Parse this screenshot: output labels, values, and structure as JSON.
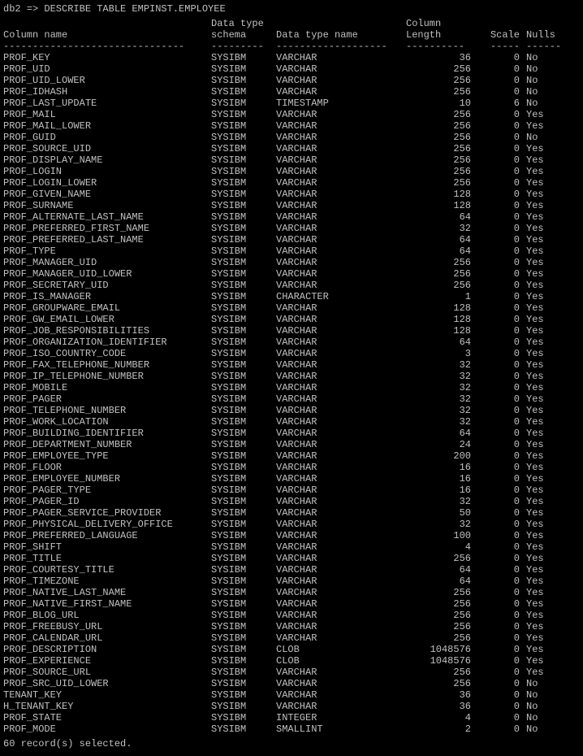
{
  "command": "db2 => DESCRIBE TABLE EMPINST.EMPLOYEE",
  "headers": {
    "col1a": "",
    "col1b": "Column name",
    "col2a": "Data type",
    "col2b": "schema",
    "col3a": "",
    "col3b": "Data type name",
    "col4a": "Column",
    "col4b": "Length",
    "col5a": "",
    "col5b": "Scale",
    "col6a": "",
    "col6b": "Nulls"
  },
  "dashes": {
    "col1": "-------------------------------",
    "col2": "---------",
    "col3": "-------------------",
    "col4": "----------",
    "col5": "-----",
    "col6": "------"
  },
  "rows": [
    {
      "name": "PROF_KEY",
      "schema": "SYSIBM",
      "type": "VARCHAR",
      "length": "36",
      "scale": "0",
      "nulls": "No"
    },
    {
      "name": "PROF_UID",
      "schema": "SYSIBM",
      "type": "VARCHAR",
      "length": "256",
      "scale": "0",
      "nulls": "No"
    },
    {
      "name": "PROF_UID_LOWER",
      "schema": "SYSIBM",
      "type": "VARCHAR",
      "length": "256",
      "scale": "0",
      "nulls": "No"
    },
    {
      "name": "PROF_IDHASH",
      "schema": "SYSIBM",
      "type": "VARCHAR",
      "length": "256",
      "scale": "0",
      "nulls": "No"
    },
    {
      "name": "PROF_LAST_UPDATE",
      "schema": "SYSIBM",
      "type": "TIMESTAMP",
      "length": "10",
      "scale": "6",
      "nulls": "No"
    },
    {
      "name": "PROF_MAIL",
      "schema": "SYSIBM",
      "type": "VARCHAR",
      "length": "256",
      "scale": "0",
      "nulls": "Yes"
    },
    {
      "name": "PROF_MAIL_LOWER",
      "schema": "SYSIBM",
      "type": "VARCHAR",
      "length": "256",
      "scale": "0",
      "nulls": "Yes"
    },
    {
      "name": "PROF_GUID",
      "schema": "SYSIBM",
      "type": "VARCHAR",
      "length": "256",
      "scale": "0",
      "nulls": "No"
    },
    {
      "name": "PROF_SOURCE_UID",
      "schema": "SYSIBM",
      "type": "VARCHAR",
      "length": "256",
      "scale": "0",
      "nulls": "Yes"
    },
    {
      "name": "PROF_DISPLAY_NAME",
      "schema": "SYSIBM",
      "type": "VARCHAR",
      "length": "256",
      "scale": "0",
      "nulls": "Yes"
    },
    {
      "name": "PROF_LOGIN",
      "schema": "SYSIBM",
      "type": "VARCHAR",
      "length": "256",
      "scale": "0",
      "nulls": "Yes"
    },
    {
      "name": "PROF_LOGIN_LOWER",
      "schema": "SYSIBM",
      "type": "VARCHAR",
      "length": "256",
      "scale": "0",
      "nulls": "Yes"
    },
    {
      "name": "PROF_GIVEN_NAME",
      "schema": "SYSIBM",
      "type": "VARCHAR",
      "length": "128",
      "scale": "0",
      "nulls": "Yes"
    },
    {
      "name": "PROF_SURNAME",
      "schema": "SYSIBM",
      "type": "VARCHAR",
      "length": "128",
      "scale": "0",
      "nulls": "Yes"
    },
    {
      "name": "PROF_ALTERNATE_LAST_NAME",
      "schema": "SYSIBM",
      "type": "VARCHAR",
      "length": "64",
      "scale": "0",
      "nulls": "Yes"
    },
    {
      "name": "PROF_PREFERRED_FIRST_NAME",
      "schema": "SYSIBM",
      "type": "VARCHAR",
      "length": "32",
      "scale": "0",
      "nulls": "Yes"
    },
    {
      "name": "PROF_PREFERRED_LAST_NAME",
      "schema": "SYSIBM",
      "type": "VARCHAR",
      "length": "64",
      "scale": "0",
      "nulls": "Yes"
    },
    {
      "name": "PROF_TYPE",
      "schema": "SYSIBM",
      "type": "VARCHAR",
      "length": "64",
      "scale": "0",
      "nulls": "Yes"
    },
    {
      "name": "PROF_MANAGER_UID",
      "schema": "SYSIBM",
      "type": "VARCHAR",
      "length": "256",
      "scale": "0",
      "nulls": "Yes"
    },
    {
      "name": "PROF_MANAGER_UID_LOWER",
      "schema": "SYSIBM",
      "type": "VARCHAR",
      "length": "256",
      "scale": "0",
      "nulls": "Yes"
    },
    {
      "name": "PROF_SECRETARY_UID",
      "schema": "SYSIBM",
      "type": "VARCHAR",
      "length": "256",
      "scale": "0",
      "nulls": "Yes"
    },
    {
      "name": "PROF_IS_MANAGER",
      "schema": "SYSIBM",
      "type": "CHARACTER",
      "length": "1",
      "scale": "0",
      "nulls": "Yes"
    },
    {
      "name": "PROF_GROUPWARE_EMAIL",
      "schema": "SYSIBM",
      "type": "VARCHAR",
      "length": "128",
      "scale": "0",
      "nulls": "Yes"
    },
    {
      "name": "PROF_GW_EMAIL_LOWER",
      "schema": "SYSIBM",
      "type": "VARCHAR",
      "length": "128",
      "scale": "0",
      "nulls": "Yes"
    },
    {
      "name": "PROF_JOB_RESPONSIBILITIES",
      "schema": "SYSIBM",
      "type": "VARCHAR",
      "length": "128",
      "scale": "0",
      "nulls": "Yes"
    },
    {
      "name": "PROF_ORGANIZATION_IDENTIFIER",
      "schema": "SYSIBM",
      "type": "VARCHAR",
      "length": "64",
      "scale": "0",
      "nulls": "Yes"
    },
    {
      "name": "PROF_ISO_COUNTRY_CODE",
      "schema": "SYSIBM",
      "type": "VARCHAR",
      "length": "3",
      "scale": "0",
      "nulls": "Yes"
    },
    {
      "name": "PROF_FAX_TELEPHONE_NUMBER",
      "schema": "SYSIBM",
      "type": "VARCHAR",
      "length": "32",
      "scale": "0",
      "nulls": "Yes"
    },
    {
      "name": "PROF_IP_TELEPHONE_NUMBER",
      "schema": "SYSIBM",
      "type": "VARCHAR",
      "length": "32",
      "scale": "0",
      "nulls": "Yes"
    },
    {
      "name": "PROF_MOBILE",
      "schema": "SYSIBM",
      "type": "VARCHAR",
      "length": "32",
      "scale": "0",
      "nulls": "Yes"
    },
    {
      "name": "PROF_PAGER",
      "schema": "SYSIBM",
      "type": "VARCHAR",
      "length": "32",
      "scale": "0",
      "nulls": "Yes"
    },
    {
      "name": "PROF_TELEPHONE_NUMBER",
      "schema": "SYSIBM",
      "type": "VARCHAR",
      "length": "32",
      "scale": "0",
      "nulls": "Yes"
    },
    {
      "name": "PROF_WORK_LOCATION",
      "schema": "SYSIBM",
      "type": "VARCHAR",
      "length": "32",
      "scale": "0",
      "nulls": "Yes"
    },
    {
      "name": "PROF_BUILDING_IDENTIFIER",
      "schema": "SYSIBM",
      "type": "VARCHAR",
      "length": "64",
      "scale": "0",
      "nulls": "Yes"
    },
    {
      "name": "PROF_DEPARTMENT_NUMBER",
      "schema": "SYSIBM",
      "type": "VARCHAR",
      "length": "24",
      "scale": "0",
      "nulls": "Yes"
    },
    {
      "name": "PROF_EMPLOYEE_TYPE",
      "schema": "SYSIBM",
      "type": "VARCHAR",
      "length": "200",
      "scale": "0",
      "nulls": "Yes"
    },
    {
      "name": "PROF_FLOOR",
      "schema": "SYSIBM",
      "type": "VARCHAR",
      "length": "16",
      "scale": "0",
      "nulls": "Yes"
    },
    {
      "name": "PROF_EMPLOYEE_NUMBER",
      "schema": "SYSIBM",
      "type": "VARCHAR",
      "length": "16",
      "scale": "0",
      "nulls": "Yes"
    },
    {
      "name": "PROF_PAGER_TYPE",
      "schema": "SYSIBM",
      "type": "VARCHAR",
      "length": "16",
      "scale": "0",
      "nulls": "Yes"
    },
    {
      "name": "PROF_PAGER_ID",
      "schema": "SYSIBM",
      "type": "VARCHAR",
      "length": "32",
      "scale": "0",
      "nulls": "Yes"
    },
    {
      "name": "PROF_PAGER_SERVICE_PROVIDER",
      "schema": "SYSIBM",
      "type": "VARCHAR",
      "length": "50",
      "scale": "0",
      "nulls": "Yes"
    },
    {
      "name": "PROF_PHYSICAL_DELIVERY_OFFICE",
      "schema": "SYSIBM",
      "type": "VARCHAR",
      "length": "32",
      "scale": "0",
      "nulls": "Yes"
    },
    {
      "name": "PROF_PREFERRED_LANGUAGE",
      "schema": "SYSIBM",
      "type": "VARCHAR",
      "length": "100",
      "scale": "0",
      "nulls": "Yes"
    },
    {
      "name": "PROF_SHIFT",
      "schema": "SYSIBM",
      "type": "VARCHAR",
      "length": "4",
      "scale": "0",
      "nulls": "Yes"
    },
    {
      "name": "PROF_TITLE",
      "schema": "SYSIBM",
      "type": "VARCHAR",
      "length": "256",
      "scale": "0",
      "nulls": "Yes"
    },
    {
      "name": "PROF_COURTESY_TITLE",
      "schema": "SYSIBM",
      "type": "VARCHAR",
      "length": "64",
      "scale": "0",
      "nulls": "Yes"
    },
    {
      "name": "PROF_TIMEZONE",
      "schema": "SYSIBM",
      "type": "VARCHAR",
      "length": "64",
      "scale": "0",
      "nulls": "Yes"
    },
    {
      "name": "PROF_NATIVE_LAST_NAME",
      "schema": "SYSIBM",
      "type": "VARCHAR",
      "length": "256",
      "scale": "0",
      "nulls": "Yes"
    },
    {
      "name": "PROF_NATIVE_FIRST_NAME",
      "schema": "SYSIBM",
      "type": "VARCHAR",
      "length": "256",
      "scale": "0",
      "nulls": "Yes"
    },
    {
      "name": "PROF_BLOG_URL",
      "schema": "SYSIBM",
      "type": "VARCHAR",
      "length": "256",
      "scale": "0",
      "nulls": "Yes"
    },
    {
      "name": "PROF_FREEBUSY_URL",
      "schema": "SYSIBM",
      "type": "VARCHAR",
      "length": "256",
      "scale": "0",
      "nulls": "Yes"
    },
    {
      "name": "PROF_CALENDAR_URL",
      "schema": "SYSIBM",
      "type": "VARCHAR",
      "length": "256",
      "scale": "0",
      "nulls": "Yes"
    },
    {
      "name": "PROF_DESCRIPTION",
      "schema": "SYSIBM",
      "type": "CLOB",
      "length": "1048576",
      "scale": "0",
      "nulls": "Yes"
    },
    {
      "name": "PROF_EXPERIENCE",
      "schema": "SYSIBM",
      "type": "CLOB",
      "length": "1048576",
      "scale": "0",
      "nulls": "Yes"
    },
    {
      "name": "PROF_SOURCE_URL",
      "schema": "SYSIBM",
      "type": "VARCHAR",
      "length": "256",
      "scale": "0",
      "nulls": "Yes"
    },
    {
      "name": "PROF_SRC_UID_LOWER",
      "schema": "SYSIBM",
      "type": "VARCHAR",
      "length": "256",
      "scale": "0",
      "nulls": "No"
    },
    {
      "name": "TENANT_KEY",
      "schema": "SYSIBM",
      "type": "VARCHAR",
      "length": "36",
      "scale": "0",
      "nulls": "No"
    },
    {
      "name": "H_TENANT_KEY",
      "schema": "SYSIBM",
      "type": "VARCHAR",
      "length": "36",
      "scale": "0",
      "nulls": "No"
    },
    {
      "name": "PROF_STATE",
      "schema": "SYSIBM",
      "type": "INTEGER",
      "length": "4",
      "scale": "0",
      "nulls": "No"
    },
    {
      "name": "PROF_MODE",
      "schema": "SYSIBM",
      "type": "SMALLINT",
      "length": "2",
      "scale": "0",
      "nulls": "No"
    }
  ],
  "footer": "  60 record(s) selected."
}
